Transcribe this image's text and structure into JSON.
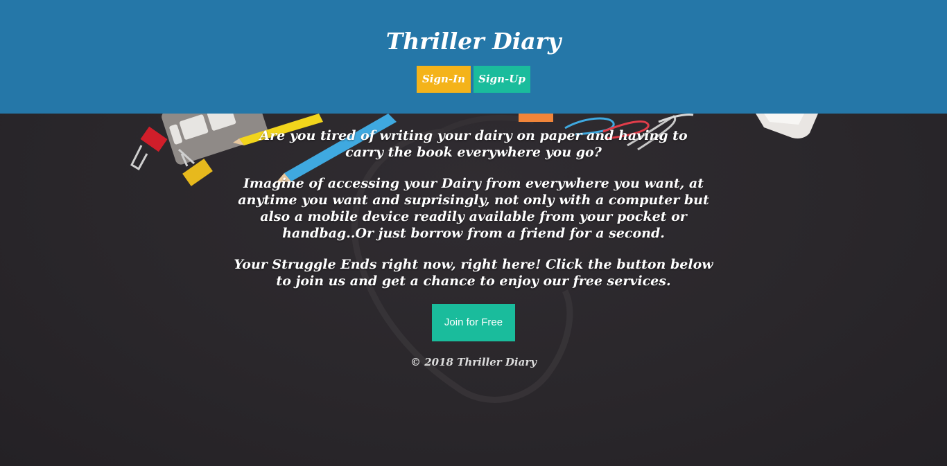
{
  "header": {
    "title": "Thriller Diary",
    "signin_label": "Sign-In",
    "signup_label": "Sign-Up"
  },
  "main": {
    "paragraphs": [
      "Are you tired of writing your dairy on paper and having to carry the book everywhere you go?",
      "Imagine of accessing your Dairy from everywhere you want, at anytime you want and suprisingly, not only with a computer but also a mobile device readily available from your pocket or handbag..Or just borrow from a friend for a second.",
      "Your Struggle Ends right now, right here! Click the button below to join us and get a chance to enjoy our free services."
    ],
    "cta_label": "Join for Free"
  },
  "footer": {
    "copyright": "© 2018 Thriller Diary"
  },
  "colors": {
    "header_bg": "#2577a8",
    "signin": "#f4b31a",
    "signup": "#1abc9c",
    "cta": "#1abc9c",
    "page_bg": "#2b282c"
  }
}
